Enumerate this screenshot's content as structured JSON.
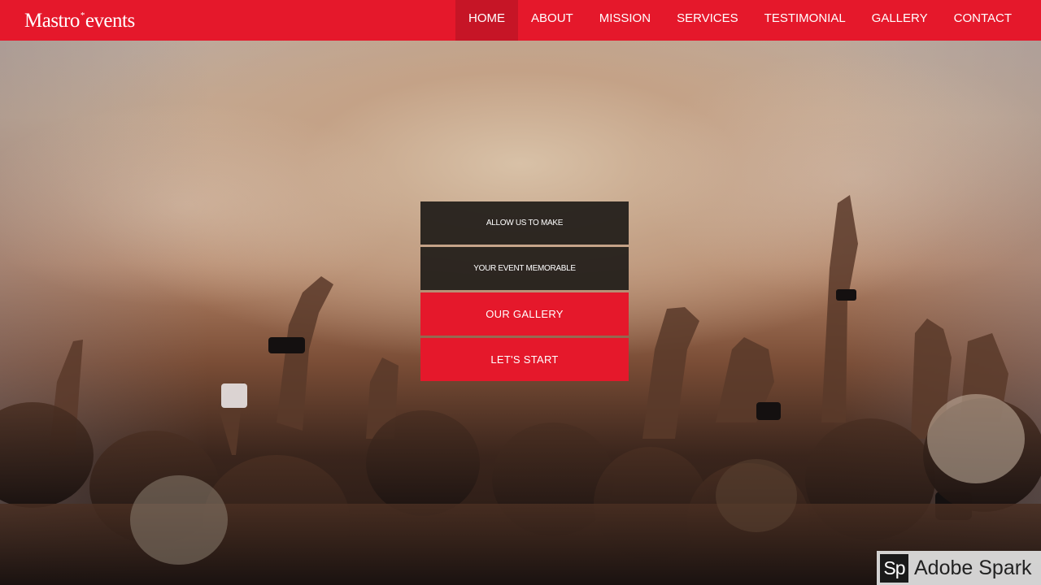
{
  "brand": {
    "part1": "Mastro",
    "star": "*",
    "part2": "events"
  },
  "nav": {
    "items": [
      {
        "label": "HOME",
        "active": true
      },
      {
        "label": "ABOUT",
        "active": false
      },
      {
        "label": "MISSION",
        "active": false
      },
      {
        "label": "SERVICES",
        "active": false
      },
      {
        "label": "TESTIMONIAL",
        "active": false
      },
      {
        "label": "GALLERY",
        "active": false
      },
      {
        "label": "CONTACT",
        "active": false
      }
    ]
  },
  "hero": {
    "line1": "ALLOW US TO MAKE",
    "line2": "YOUR EVENT MEMORABLE",
    "gallery_button": "OUR GALLERY",
    "start_button": "LET'S START",
    "background": "concert-crowd-image"
  },
  "watermark": {
    "logo": "Sp",
    "text": "Adobe Spark"
  },
  "colors": {
    "brand_red": "#e5182b",
    "active_nav": "#c61526",
    "dark_box": "#231f1b",
    "white": "#ffffff"
  }
}
